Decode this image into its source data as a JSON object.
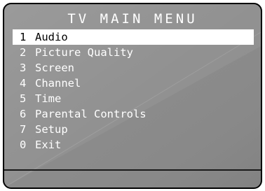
{
  "menu": {
    "title": "TV MAIN MENU",
    "selected_index": 0,
    "items": [
      {
        "num": "1",
        "label": "Audio"
      },
      {
        "num": "2",
        "label": "Picture Quality"
      },
      {
        "num": "3",
        "label": "Screen"
      },
      {
        "num": "4",
        "label": "Channel"
      },
      {
        "num": "5",
        "label": "Time"
      },
      {
        "num": "6",
        "label": "Parental Controls"
      },
      {
        "num": "7",
        "label": "Setup"
      },
      {
        "num": "0",
        "label": "Exit"
      }
    ]
  },
  "colors": {
    "background": "#8f8f8f",
    "text": "#ffffff",
    "highlight_background": "#ffffff",
    "highlight_text": "#000000",
    "border": "#000000"
  }
}
